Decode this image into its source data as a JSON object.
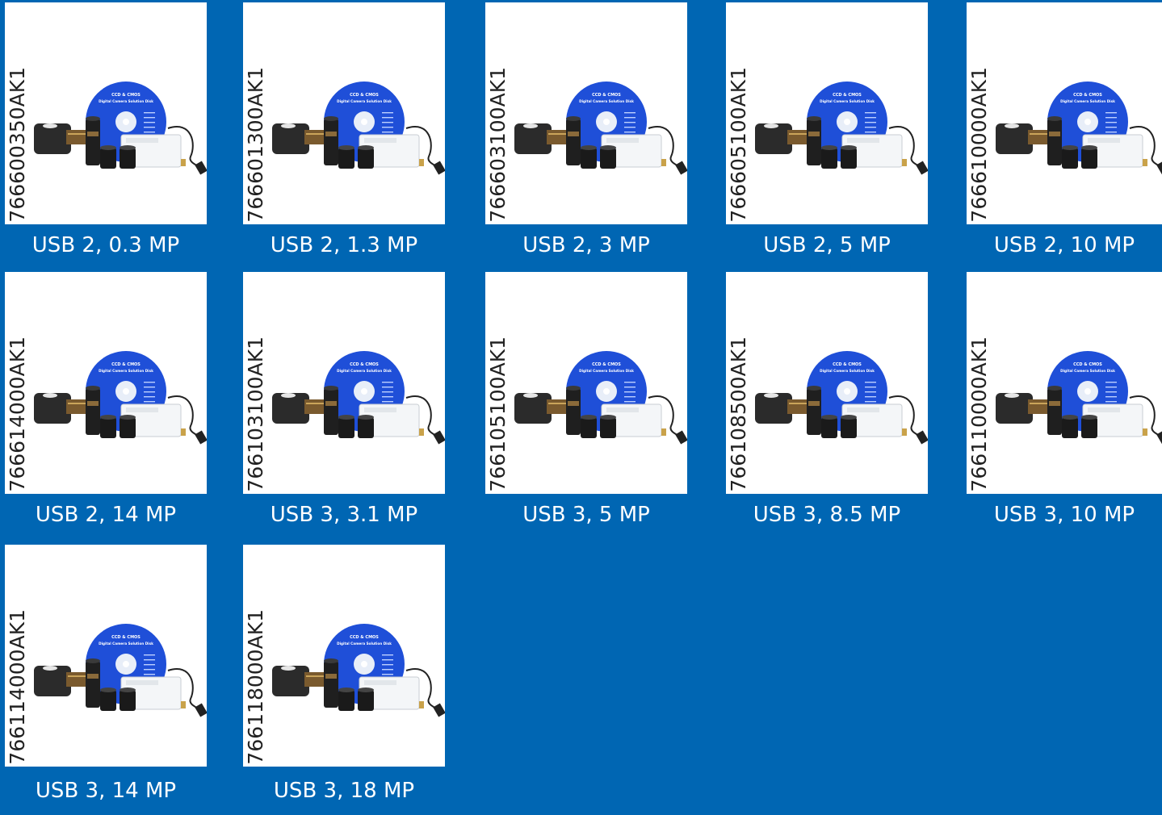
{
  "products": [
    {
      "sku": "766600350AK1",
      "label": "USB 2, 0.3 MP"
    },
    {
      "sku": "766601300AK1",
      "label": "USB 2, 1.3 MP"
    },
    {
      "sku": "766603100AK1",
      "label": "USB 2, 3 MP"
    },
    {
      "sku": "766605100AK1",
      "label": "USB 2, 5 MP"
    },
    {
      "sku": "766610000AK1",
      "label": "USB 2, 10 MP"
    },
    {
      "sku": "766614000AK1",
      "label": "USB 2, 14 MP"
    },
    {
      "sku": "766103100AK1",
      "label": "USB 3, 3.1 MP"
    },
    {
      "sku": "766105100AK1",
      "label": "USB 3, 5 MP"
    },
    {
      "sku": "766108500AK1",
      "label": "USB 3, 8.5 MP"
    },
    {
      "sku": "766110000AK1",
      "label": "USB 3, 10 MP"
    },
    {
      "sku": "766114000AK1",
      "label": "USB 3, 14 MP"
    },
    {
      "sku": "766118000AK1",
      "label": "USB 3, 18 MP"
    }
  ],
  "disc": {
    "title": "CCD & CMOS",
    "subtitle": "Digital Camera Solution Disk"
  },
  "colors": {
    "background": "#0066b3",
    "disc": "#1f4fd8",
    "caption_text": "#ffffff"
  }
}
